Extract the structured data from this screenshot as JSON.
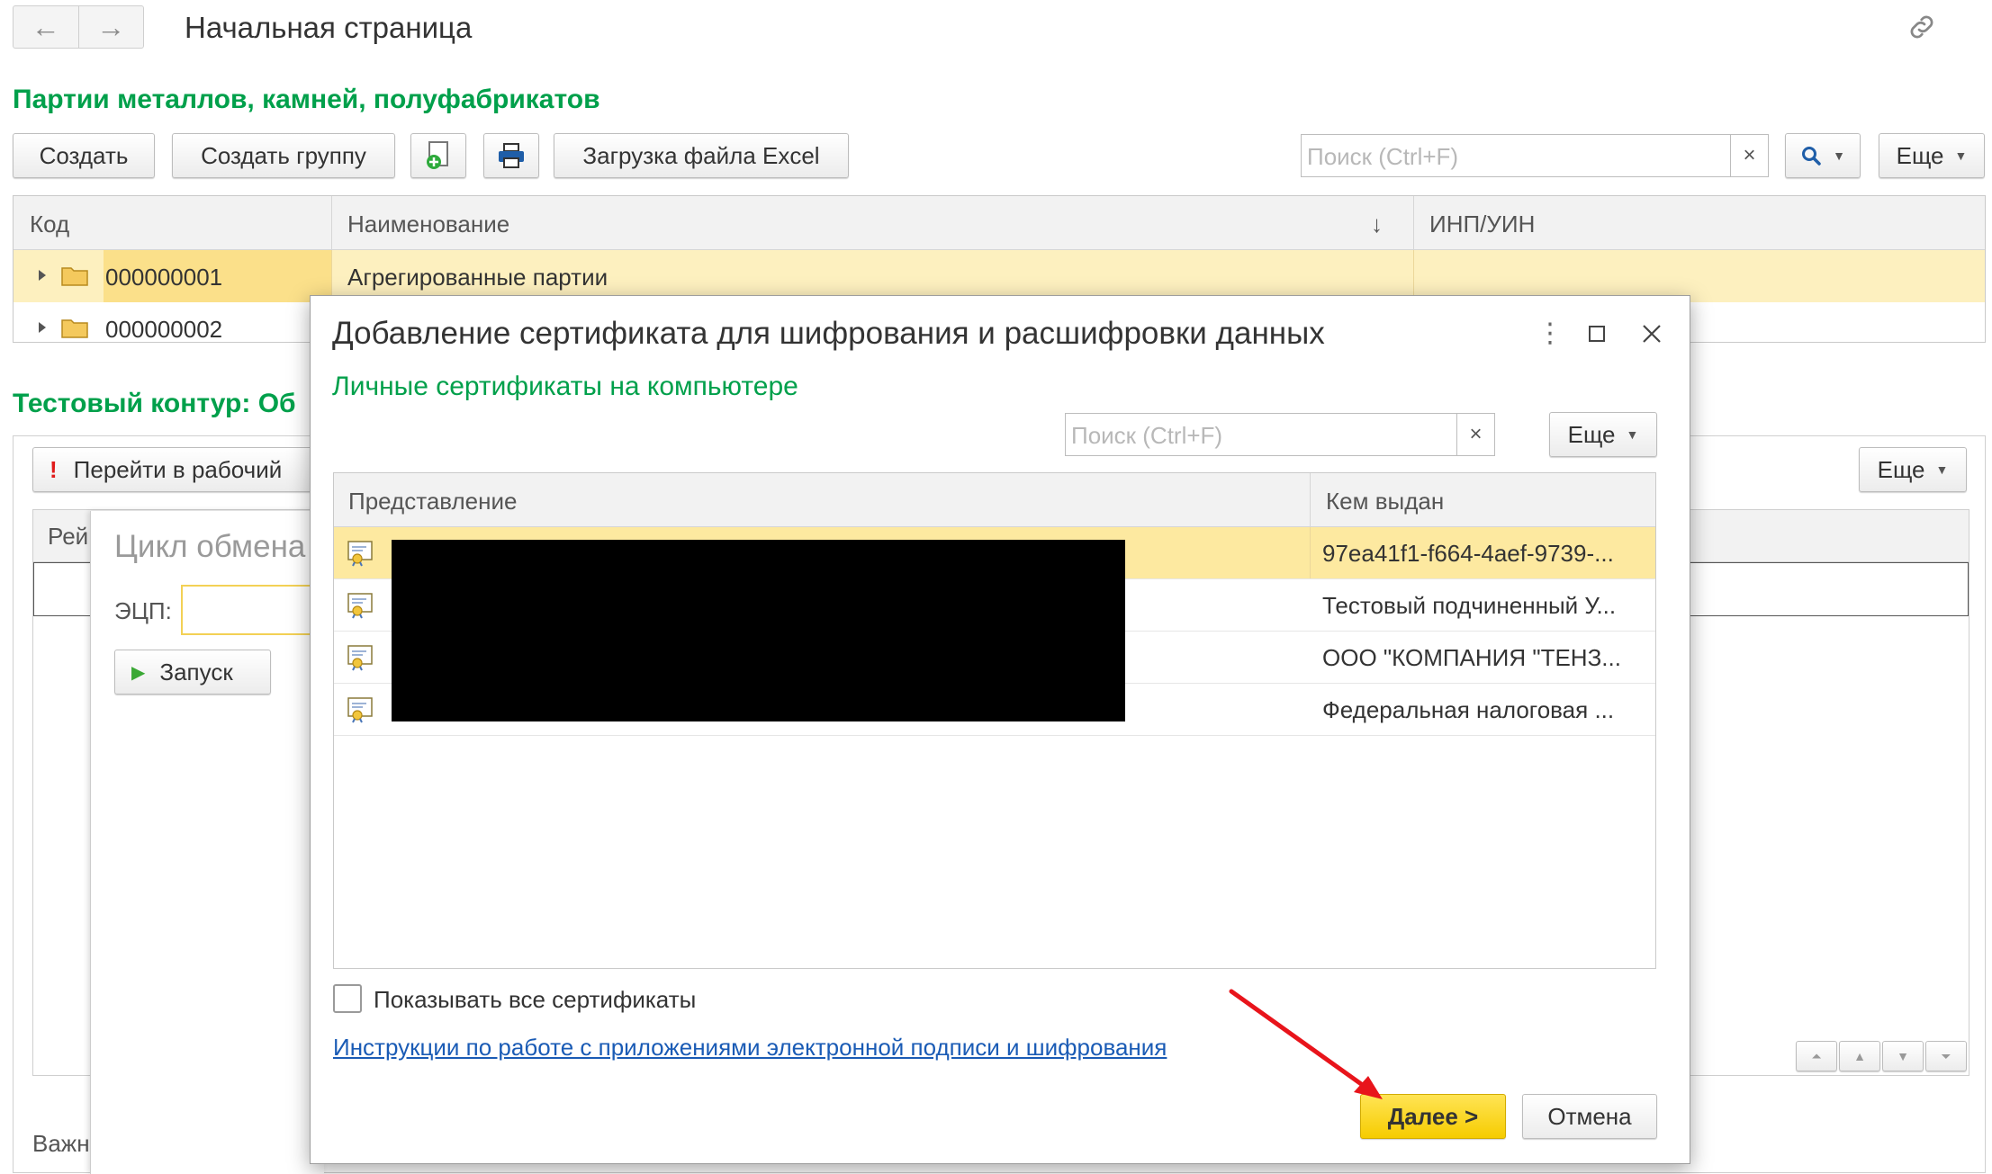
{
  "topbar": {
    "back_icon": "arrow-left-icon",
    "forward_icon": "arrow-right-icon",
    "title": "Начальная страница",
    "link_icon": "link-icon"
  },
  "catalog": {
    "title": "Партии металлов, камней, полуфабрикатов",
    "toolbar": {
      "create": "Создать",
      "create_group": "Создать группу",
      "excel": "Загрузка файла Excel",
      "search_placeholder": "Поиск (Ctrl+F)",
      "search_clear": "×",
      "more": "Еще"
    },
    "columns": [
      "Код",
      "Наименование",
      "ИНП/УИН"
    ],
    "sort_indicator": "↓",
    "rows": [
      {
        "code": "000000001",
        "name": "Агрегированные партии",
        "inp": ""
      },
      {
        "code": "000000002",
        "name": "",
        "inp": ""
      }
    ]
  },
  "test_section": {
    "title": "Тестовый контур: Об",
    "goto_button": "Перейти в рабочий",
    "more": "Еще",
    "column_partial": "Рей",
    "footer_partial": "Важн"
  },
  "exchange_form": {
    "title": "Цикл обмена",
    "ecp_label": "ЭЦП:",
    "run_button": "Запуск"
  },
  "dialog": {
    "title": "Добавление сертификата для шифрования и расшифровки данных",
    "subtitle": "Личные сертификаты на компьютере",
    "search_placeholder": "Поиск (Ctrl+F)",
    "search_clear": "×",
    "more": "Еще",
    "columns": [
      "Представление",
      "Кем выдан"
    ],
    "certificates": [
      {
        "issuer": "97ea41f1-f664-4aef-9739-..."
      },
      {
        "issuer": "Тестовый подчиненный У..."
      },
      {
        "issuer": "ООО \"КОМПАНИЯ \"ТЕНЗ..."
      },
      {
        "issuer": "Федеральная налоговая ..."
      }
    ],
    "show_all_label": "Показывать все сертификаты",
    "instructions_link": "Инструкции по работе с приложениями электронной подписи и шифрования",
    "next_button": "Далее >",
    "cancel_button": "Отмена"
  },
  "colors": {
    "accent_green": "#00a04b",
    "selection_yellow": "#fde9a0",
    "primary_yellow": "#f6cc00",
    "link_blue": "#1a5bb5",
    "annotation_red": "#e8141b"
  }
}
